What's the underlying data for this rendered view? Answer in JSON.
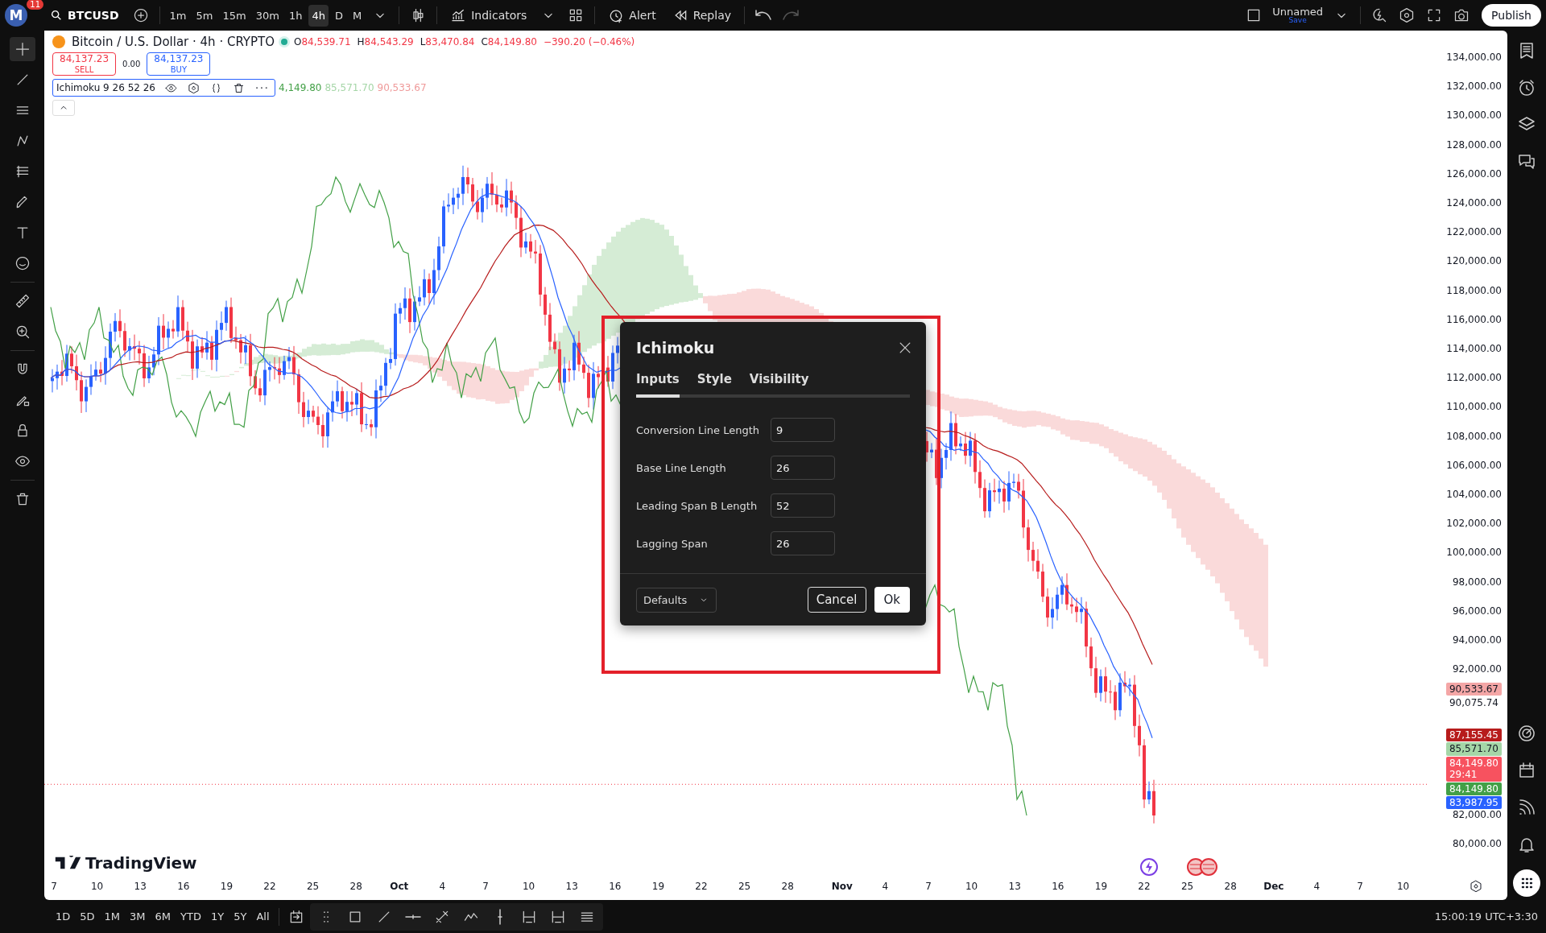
{
  "top_bar": {
    "avatar": "M",
    "notification_count": "11",
    "symbol": "BTCUSD",
    "intervals": [
      {
        "label": "1m",
        "selected": false
      },
      {
        "label": "5m",
        "selected": false
      },
      {
        "label": "15m",
        "selected": false
      },
      {
        "label": "30m",
        "selected": false
      },
      {
        "label": "1h",
        "selected": false
      },
      {
        "label": "4h",
        "selected": true
      },
      {
        "label": "D",
        "selected": false
      },
      {
        "label": "M",
        "selected": false
      }
    ],
    "indicators": "Indicators",
    "alert": "Alert",
    "replay": "Replay",
    "layout_name": "Unnamed",
    "save": "Save",
    "publish": "Publish"
  },
  "legend": {
    "title": "Bitcoin / U.S. Dollar · 4h · CRYPTO",
    "ohlc": [
      {
        "key": "O",
        "value": "84,539.71"
      },
      {
        "key": "H",
        "value": "84,543.29"
      },
      {
        "key": "L",
        "value": "83,470.84"
      },
      {
        "key": "C",
        "value": "84,149.80"
      }
    ],
    "change": "−390.20 (−0.46%)",
    "sell": {
      "price": "84,137.23",
      "label": "SELL"
    },
    "spread": "0.00",
    "buy": {
      "price": "84,137.23",
      "label": "BUY"
    },
    "indicator": {
      "name": "Ichimoku 9 26 52 26",
      "values": [
        {
          "text": "4,149.80",
          "color": "#43a047"
        },
        {
          "text": "85,571.70",
          "color": "#a5d6a7"
        },
        {
          "text": "90,533.67",
          "color": "#ef9a9a"
        }
      ]
    }
  },
  "price_axis": {
    "ticks": [
      "134,000.00",
      "132,000.00",
      "130,000.00",
      "128,000.00",
      "126,000.00",
      "124,000.00",
      "122,000.00",
      "120,000.00",
      "118,000.00",
      "116,000.00",
      "114,000.00",
      "112,000.00",
      "110,000.00",
      "108,000.00",
      "106,000.00",
      "104,000.00",
      "102,000.00",
      "100,000.00",
      "98,000.00",
      "96,000.00",
      "94,000.00",
      "92,000.00"
    ],
    "upper_labels": [
      {
        "kind": "tag",
        "text": "90,533.67",
        "color": "#f4a6a6"
      },
      {
        "kind": "plain",
        "text": "90,075.74"
      }
    ],
    "lower_labels": [
      {
        "kind": "tag",
        "text": "87,155.45",
        "color": "#b71c1c"
      },
      {
        "kind": "tag",
        "text": "85,571.70",
        "color": "#a5d6a7"
      },
      {
        "kind": "tag",
        "text": "84,149.80",
        "sub": "29:41",
        "color": "#f7525f"
      },
      {
        "kind": "tag",
        "text": "84,149.80",
        "color": "#43a047"
      },
      {
        "kind": "tag",
        "text": "83,987.95",
        "color": "#2962ff"
      }
    ],
    "bottom_ticks": [
      "82,000.00",
      "80,000.00"
    ]
  },
  "time_axis": [
    {
      "text": "7",
      "kind": "day"
    },
    {
      "text": "10",
      "kind": "day"
    },
    {
      "text": "13",
      "kind": "day"
    },
    {
      "text": "16",
      "kind": "day"
    },
    {
      "text": "19",
      "kind": "day"
    },
    {
      "text": "22",
      "kind": "day"
    },
    {
      "text": "25",
      "kind": "day"
    },
    {
      "text": "28",
      "kind": "day"
    },
    {
      "text": "Oct",
      "kind": "month"
    },
    {
      "text": "4",
      "kind": "day"
    },
    {
      "text": "7",
      "kind": "day"
    },
    {
      "text": "10",
      "kind": "day"
    },
    {
      "text": "13",
      "kind": "day"
    },
    {
      "text": "16",
      "kind": "day"
    },
    {
      "text": "19",
      "kind": "day"
    },
    {
      "text": "22",
      "kind": "day"
    },
    {
      "text": "25",
      "kind": "day"
    },
    {
      "text": "28",
      "kind": "day"
    },
    {
      "text": "Nov",
      "kind": "month"
    },
    {
      "text": "4",
      "kind": "day"
    },
    {
      "text": "7",
      "kind": "day"
    },
    {
      "text": "10",
      "kind": "day"
    },
    {
      "text": "13",
      "kind": "day"
    },
    {
      "text": "16",
      "kind": "day"
    },
    {
      "text": "19",
      "kind": "day"
    },
    {
      "text": "22",
      "kind": "day"
    },
    {
      "text": "25",
      "kind": "day"
    },
    {
      "text": "28",
      "kind": "day"
    },
    {
      "text": "Dec",
      "kind": "month"
    },
    {
      "text": "4",
      "kind": "day"
    },
    {
      "text": "7",
      "kind": "day"
    },
    {
      "text": "10",
      "kind": "day"
    }
  ],
  "logo": "TradingView",
  "dialog": {
    "title": "Ichimoku",
    "tabs": [
      {
        "label": "Inputs",
        "selected": true
      },
      {
        "label": "Style",
        "selected": false
      },
      {
        "label": "Visibility",
        "selected": false
      }
    ],
    "fields": [
      {
        "label": "Conversion Line Length",
        "value": "9"
      },
      {
        "label": "Base Line Length",
        "value": "26"
      },
      {
        "label": "Leading Span B Length",
        "value": "52"
      },
      {
        "label": "Lagging Span",
        "value": "26"
      }
    ],
    "defaults": "Defaults",
    "cancel": "Cancel",
    "ok": "Ok"
  },
  "bottom_bar": {
    "ranges": [
      "1D",
      "5D",
      "1M",
      "3M",
      "6M",
      "YTD",
      "1Y",
      "5Y",
      "All"
    ],
    "clock": "15:00:19 UTC+3:30"
  }
}
